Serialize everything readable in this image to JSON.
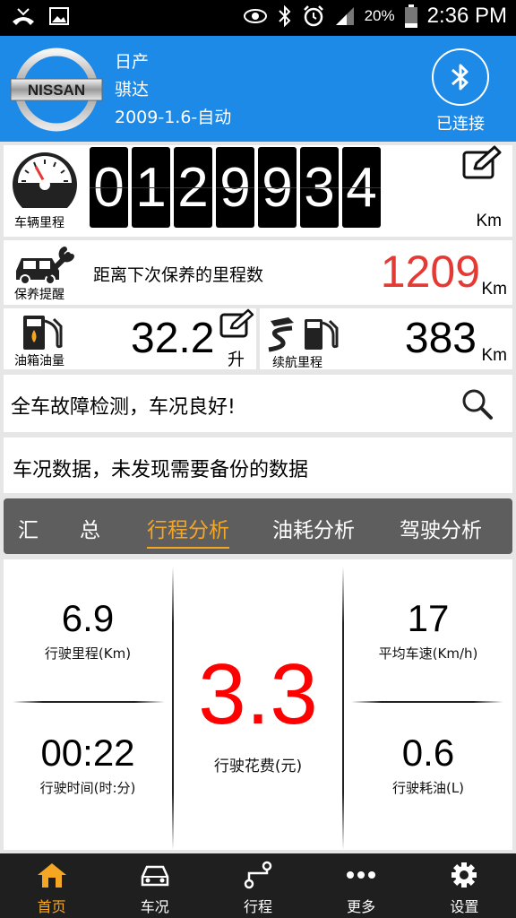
{
  "status_bar": {
    "battery_pct": "20%",
    "time": "2:36 PM"
  },
  "header": {
    "brand_logo_text": "NISSAN",
    "make": "日产",
    "model": "骐达",
    "variant": "2009-1.6-自动",
    "bt_status": "已连接"
  },
  "odometer": {
    "label": "车辆里程",
    "digits": [
      "0",
      "1",
      "2",
      "9",
      "9",
      "3",
      "4"
    ],
    "unit": "Km"
  },
  "maintenance": {
    "label": "保养提醒",
    "text": "距离下次保养的里程数",
    "value": "1209",
    "unit": "Km"
  },
  "fuel": {
    "label": "油箱油量",
    "value": "32.2",
    "unit": "升"
  },
  "range": {
    "label": "续航里程",
    "value": "383",
    "unit": "Km"
  },
  "diagnostics": {
    "text": "全车故障检测，车况良好!"
  },
  "backup": {
    "text": "车况数据，未发现需要备份的数据"
  },
  "tabs": [
    {
      "label": "汇　　总"
    },
    {
      "label": "行程分析"
    },
    {
      "label": "油耗分析"
    },
    {
      "label": "驾驶分析"
    }
  ],
  "stats": {
    "distance": {
      "value": "6.9",
      "label": "行驶里程(Km)"
    },
    "time": {
      "value": "00:22",
      "label": "行驶时间(时:分)"
    },
    "cost": {
      "value": "3.3",
      "label": "行驶花费(元)"
    },
    "avg_speed": {
      "value": "17",
      "label": "平均车速(Km/h)"
    },
    "fuel_used": {
      "value": "0.6",
      "label": "行驶耗油(L)"
    }
  },
  "nav": [
    {
      "label": "首页",
      "icon": "home-icon"
    },
    {
      "label": "车况",
      "icon": "car-icon"
    },
    {
      "label": "行程",
      "icon": "route-icon"
    },
    {
      "label": "更多",
      "icon": "more-icon"
    },
    {
      "label": "设置",
      "icon": "gear-icon"
    }
  ],
  "colors": {
    "accent_blue": "#1e8ae8",
    "highlight_red": "#e53935",
    "active_orange": "#f5a623"
  }
}
